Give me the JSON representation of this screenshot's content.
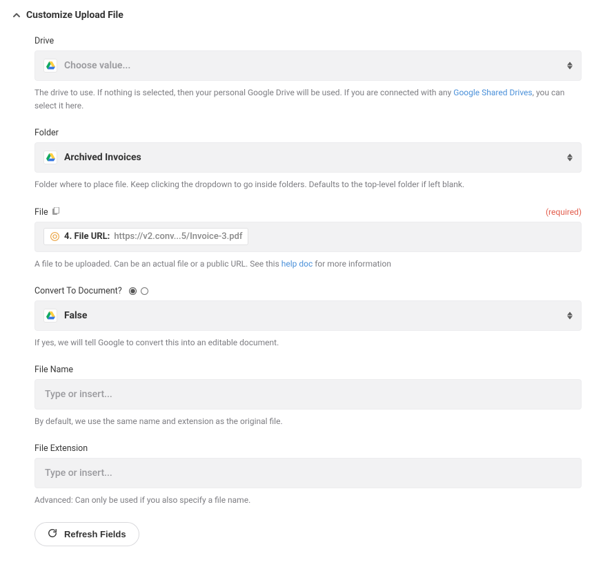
{
  "header": {
    "title": "Customize Upload File"
  },
  "fields": {
    "drive": {
      "label": "Drive",
      "placeholder": "Choose value...",
      "value": "",
      "help_pre": "The drive to use. If nothing is selected, then your personal Google Drive will be used. If you are connected with any ",
      "help_link": "Google Shared Drives",
      "help_post": ", you can select it here."
    },
    "folder": {
      "label": "Folder",
      "value": "Archived Invoices",
      "help": "Folder where to place file. Keep clicking the dropdown to go inside folders. Defaults to the top-level folder if left blank."
    },
    "file": {
      "label": "File",
      "required_text": "(required)",
      "pill_label": "4. File URL:",
      "pill_value": "https://v2.conv...5/Invoice-3.pdf",
      "help_pre": "A file to be uploaded. Can be an actual file or a public URL. See this ",
      "help_link": "help doc",
      "help_post": " for more information"
    },
    "convert": {
      "label": "Convert To Document?",
      "value": "False",
      "help": "If yes, we will tell Google to convert this into an editable document."
    },
    "filename": {
      "label": "File Name",
      "placeholder": "Type or insert...",
      "value": "",
      "help": "By default, we use the same name and extension as the original file."
    },
    "fileext": {
      "label": "File Extension",
      "placeholder": "Type or insert...",
      "value": "",
      "help": "Advanced: Can only be used if you also specify a file name."
    }
  },
  "refresh_label": "Refresh Fields"
}
